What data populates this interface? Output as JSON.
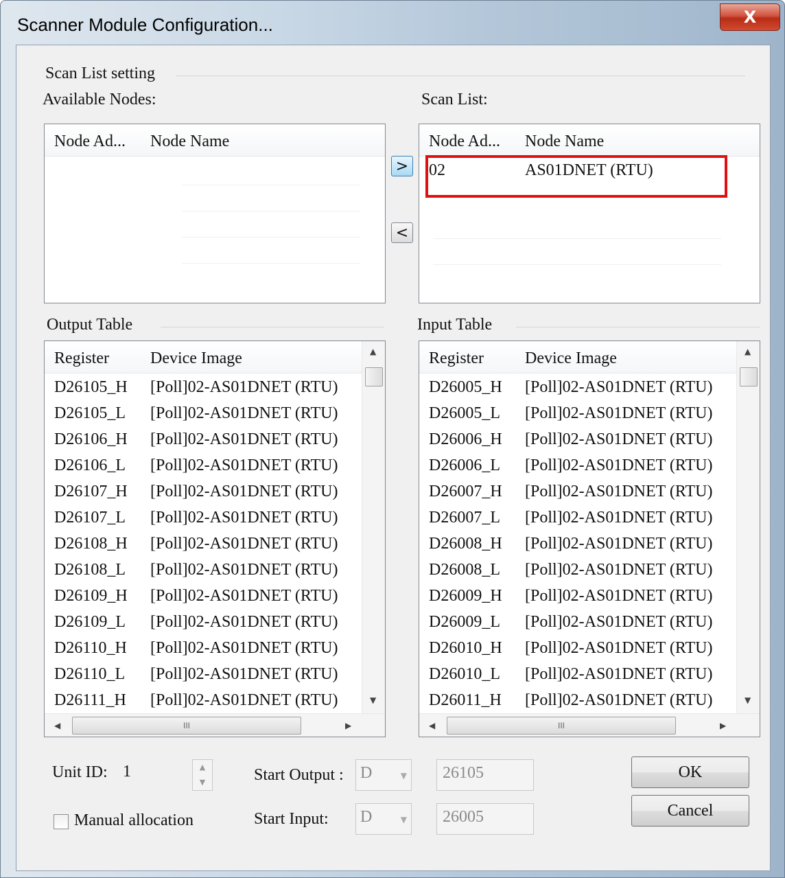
{
  "window": {
    "title": "Scanner Module Configuration...",
    "close_glyph": "X"
  },
  "scan_list_setting": "Scan List setting",
  "available_nodes": {
    "label": "Available Nodes:",
    "columns": [
      "Node Ad...",
      "Node Name"
    ],
    "rows": []
  },
  "move_buttons": {
    "add": ">",
    "remove": "<"
  },
  "scan_list": {
    "label": "Scan List:",
    "columns": [
      "Node Ad...",
      "Node Name"
    ],
    "rows": [
      {
        "address": "02",
        "name": "AS01DNET (RTU)"
      }
    ]
  },
  "output_table": {
    "label": "Output Table",
    "columns": [
      "Register",
      "Device Image"
    ],
    "rows": [
      {
        "register": "D26105_H",
        "image": "[Poll]02-AS01DNET (RTU)"
      },
      {
        "register": "D26105_L",
        "image": "[Poll]02-AS01DNET (RTU)"
      },
      {
        "register": "D26106_H",
        "image": "[Poll]02-AS01DNET (RTU)"
      },
      {
        "register": "D26106_L",
        "image": "[Poll]02-AS01DNET (RTU)"
      },
      {
        "register": "D26107_H",
        "image": "[Poll]02-AS01DNET (RTU)"
      },
      {
        "register": "D26107_L",
        "image": "[Poll]02-AS01DNET (RTU)"
      },
      {
        "register": "D26108_H",
        "image": "[Poll]02-AS01DNET (RTU)"
      },
      {
        "register": "D26108_L",
        "image": "[Poll]02-AS01DNET (RTU)"
      },
      {
        "register": "D26109_H",
        "image": "[Poll]02-AS01DNET (RTU)"
      },
      {
        "register": "D26109_L",
        "image": "[Poll]02-AS01DNET (RTU)"
      },
      {
        "register": "D26110_H",
        "image": "[Poll]02-AS01DNET (RTU)"
      },
      {
        "register": "D26110_L",
        "image": "[Poll]02-AS01DNET (RTU)"
      },
      {
        "register": "D26111_H",
        "image": "[Poll]02-AS01DNET (RTU)"
      }
    ]
  },
  "input_table": {
    "label": "Input Table",
    "columns": [
      "Register",
      "Device Image"
    ],
    "rows": [
      {
        "register": "D26005_H",
        "image": "[Poll]02-AS01DNET (RTU)"
      },
      {
        "register": "D26005_L",
        "image": "[Poll]02-AS01DNET (RTU)"
      },
      {
        "register": "D26006_H",
        "image": "[Poll]02-AS01DNET (RTU)"
      },
      {
        "register": "D26006_L",
        "image": "[Poll]02-AS01DNET (RTU)"
      },
      {
        "register": "D26007_H",
        "image": "[Poll]02-AS01DNET (RTU)"
      },
      {
        "register": "D26007_L",
        "image": "[Poll]02-AS01DNET (RTU)"
      },
      {
        "register": "D26008_H",
        "image": "[Poll]02-AS01DNET (RTU)"
      },
      {
        "register": "D26008_L",
        "image": "[Poll]02-AS01DNET (RTU)"
      },
      {
        "register": "D26009_H",
        "image": "[Poll]02-AS01DNET (RTU)"
      },
      {
        "register": "D26009_L",
        "image": "[Poll]02-AS01DNET (RTU)"
      },
      {
        "register": "D26010_H",
        "image": "[Poll]02-AS01DNET (RTU)"
      },
      {
        "register": "D26010_L",
        "image": "[Poll]02-AS01DNET (RTU)"
      },
      {
        "register": "D26011_H",
        "image": "[Poll]02-AS01DNET (RTU)"
      }
    ]
  },
  "scrollbar": {
    "thumb_grip": "III",
    "up": "▲",
    "down": "▼",
    "left": "◀",
    "right": "▶"
  },
  "bottom": {
    "unit_id_label": "Unit ID:",
    "unit_id_value": "1",
    "start_output_label": "Start Output :",
    "start_output_device": "D",
    "start_output_value": "26105",
    "start_input_label": "Start Input:",
    "start_input_device": "D",
    "start_input_value": "26005",
    "manual_allocation_label": "Manual allocation",
    "manual_allocation_checked": false
  },
  "buttons": {
    "ok": "OK",
    "cancel": "Cancel"
  },
  "colors": {
    "highlight": "#e01010",
    "close_button": "#c8412b"
  }
}
